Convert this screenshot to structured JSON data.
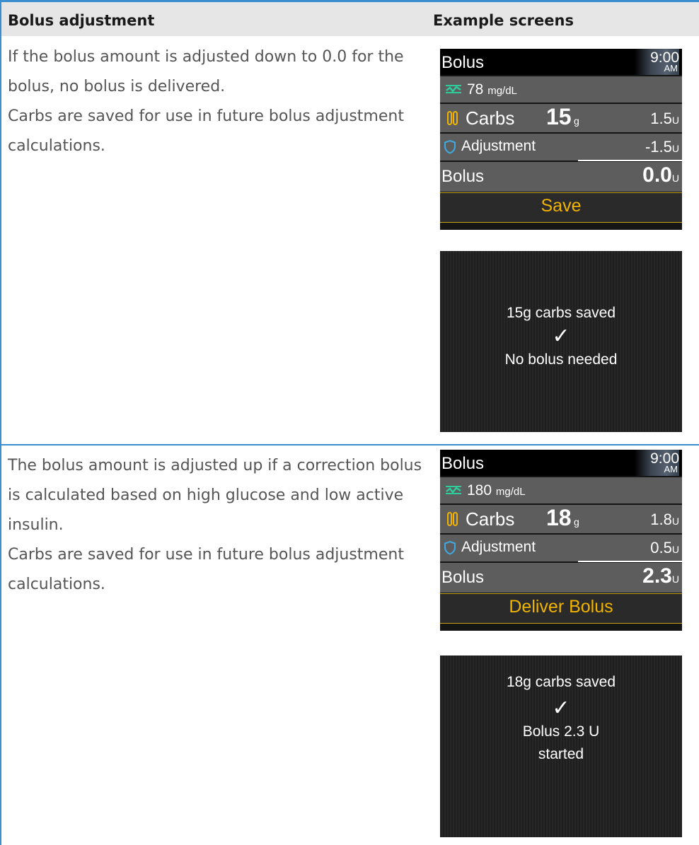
{
  "header": {
    "left": "Bolus adjustment",
    "right": "Example screens"
  },
  "rows": [
    {
      "para1": "If the bolus amount is adjusted down to 0.0 for the bolus, no bolus is delivered.",
      "para2": "Carbs are saved for use in future bolus adjustment calculations.",
      "screen": {
        "title": "Bolus",
        "time": "9:00",
        "ampm": "AM",
        "glucose": "78",
        "glucose_unit": "mg/dL",
        "carbs_label": "Carbs",
        "carbs_value": "15",
        "carbs_unit": "g",
        "carbs_insulin": "1.5",
        "adjustment_label": "Adjustment",
        "adjustment_value": "-1.5",
        "bolus_label": "Bolus",
        "bolus_value": "0.0",
        "unit": "U",
        "action": "Save"
      },
      "confirm": {
        "line1": "15g carbs saved",
        "check": "✓",
        "line2": "No bolus needed",
        "line3": ""
      }
    },
    {
      "para1": "The bolus amount is adjusted up if a correction bolus is calculated based on high glucose and low active insulin.",
      "para2": "Carbs are saved for use in future bolus adjustment calculations.",
      "screen": {
        "title": "Bolus",
        "time": "9:00",
        "ampm": "AM",
        "glucose": "180",
        "glucose_unit": "mg/dL",
        "carbs_label": "Carbs",
        "carbs_value": "18",
        "carbs_unit": "g",
        "carbs_insulin": "1.8",
        "adjustment_label": "Adjustment",
        "adjustment_value": "0.5",
        "bolus_label": "Bolus",
        "bolus_value": "2.3",
        "unit": "U",
        "action": "Deliver Bolus"
      },
      "confirm": {
        "line1": "18g carbs saved",
        "check": "✓",
        "line2": "Bolus 2.3 U",
        "line3": "started"
      }
    }
  ],
  "colors": {
    "accent": "#3b8fd0",
    "header_bg": "#e6e6e6",
    "action_text": "#f0b400",
    "glucose_icon": "#2ecc9a",
    "adjust_icon": "#3fa9e0",
    "carbs_icon": "#f0b400"
  },
  "icons": {
    "glucose": "cgm-trend-icon",
    "carbs": "carbs-icon",
    "adjustment": "shield-icon",
    "confirm": "checkmark-icon"
  }
}
